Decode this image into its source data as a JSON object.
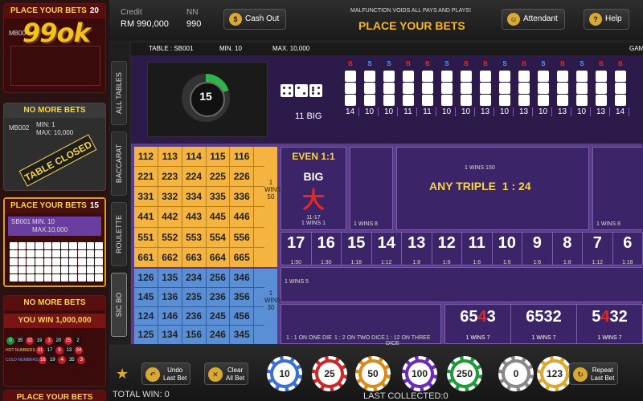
{
  "brand": {
    "logo_text": "99ok"
  },
  "left_panel": {
    "card1": {
      "title": "PLACE YOUR BETS",
      "count": "20",
      "table": "MB00"
    },
    "card2": {
      "title": "NO MORE BETS",
      "table": "MB002",
      "min": "MIN: 1",
      "max": "MAX: 10,000",
      "stamp": "TABLE CLOSED"
    },
    "card3": {
      "title": "PLACE YOUR BETS",
      "count": "15",
      "table": "SB001",
      "min": "MIN. 10",
      "max": "MAX.10,000"
    },
    "card4": {
      "title": "NO MORE BETS",
      "win": "YOU WIN 1,000,000",
      "hot_label": "HOT NUMBERS",
      "cold_label": "COLD NUMBERS",
      "beads1": [
        "0",
        "35",
        "32",
        "19",
        "3",
        "20",
        "25",
        "2"
      ],
      "beads2": [
        "31",
        "17",
        "9",
        "13",
        "34"
      ],
      "beads3": [
        "16",
        "19",
        "4",
        "35",
        "3"
      ]
    },
    "card5": {
      "title": "PLACE YOUR BETS"
    }
  },
  "side_tabs": [
    "ALL TABLES",
    "BACCARAT",
    "ROULETTE",
    "SIC BO"
  ],
  "top_bar": {
    "credit_label": "Credit",
    "credit_value": "RM 990,000",
    "nn_label": "NN",
    "nn_value": "990",
    "cashout": "Cash Out",
    "malfunction": "MALFUNCTION VOIDS ALL PAYS AND PLAYS!",
    "status": "PLACE YOUR BETS",
    "attendant": "Attendant",
    "help": "Help"
  },
  "table_info": {
    "table": "TABLE : SB001",
    "min": "MIN.   10",
    "max": "MAX.  10,000",
    "right": "GAM"
  },
  "timer": {
    "value": "15",
    "progress": 0.2
  },
  "last_result": {
    "label": "11 BIG"
  },
  "history": {
    "bs": [
      "B",
      "S",
      "S",
      "B",
      "B",
      "S",
      "B",
      "B",
      "S",
      "B",
      "S",
      "B",
      "S",
      "B",
      "B"
    ],
    "totals": [
      "14",
      "10",
      "10",
      "11",
      "11",
      "10",
      "10",
      "13",
      "10",
      "13",
      "10",
      "13",
      "10",
      "13",
      "14"
    ]
  },
  "big_area": {
    "even": "EVEN 1:1",
    "big": "BIG",
    "char": "大",
    "range": "11-17",
    "wins": "1 WINS 1"
  },
  "triples": {
    "any": "ANY TRIPLE",
    "odds": "1 : 24",
    "wins150": "1 WINS 150",
    "wins8a": "1 WINS 8",
    "wins8b": "1 WINS 8"
  },
  "grid_triples": [
    [
      "112",
      "113",
      "114",
      "115",
      "116"
    ],
    [
      "221",
      "223",
      "224",
      "225",
      "226"
    ],
    [
      "331",
      "332",
      "334",
      "335",
      "336"
    ],
    [
      "441",
      "442",
      "443",
      "445",
      "446"
    ],
    [
      "551",
      "552",
      "553",
      "554",
      "556"
    ],
    [
      "661",
      "662",
      "663",
      "664",
      "665"
    ]
  ],
  "grid_wins_a": "1 WINS 50",
  "grid_combos": [
    [
      "126",
      "135",
      "234",
      "256",
      "346"
    ],
    [
      "145",
      "136",
      "235",
      "236",
      "356"
    ],
    [
      "124",
      "146",
      "236",
      "245",
      "456"
    ],
    [
      "125",
      "134",
      "156",
      "246",
      "345"
    ]
  ],
  "grid_wins_b": "1 WINS 30",
  "totals": [
    {
      "n": "17",
      "o": "1:50"
    },
    {
      "n": "16",
      "o": "1:30"
    },
    {
      "n": "15",
      "o": "1:18"
    },
    {
      "n": "14",
      "o": "1:12"
    },
    {
      "n": "13",
      "o": "1:8"
    },
    {
      "n": "12",
      "o": "1:6"
    },
    {
      "n": "11",
      "o": "1:6"
    },
    {
      "n": "10",
      "o": "1:6"
    },
    {
      "n": "9",
      "o": "1:6"
    },
    {
      "n": "8",
      "o": "1:8"
    },
    {
      "n": "7",
      "o": "1:12"
    },
    {
      "n": "6",
      "o": "1:18"
    }
  ],
  "combo_wins": "1 WINS 5",
  "singles": {
    "one": "1 : 1 ON ONE DIE",
    "two": "1 : 2 ON TWO DICE",
    "three": "1 : 12 ON THREE DICE"
  },
  "sequences": [
    {
      "d": [
        "6",
        "5",
        "4",
        "3"
      ],
      "red": 2,
      "wins": "1 WINS 7"
    },
    {
      "d": [
        "6",
        "5",
        "3",
        "2"
      ],
      "red": -1,
      "wins": "1 WINS 7"
    },
    {
      "d": [
        "5",
        "4",
        "3",
        "2"
      ],
      "red": 1,
      "wins": "1 WINS 7"
    }
  ],
  "bottom_bar": {
    "undo": "Undo\nLast Bet",
    "clear": "Clear\nAll Bet",
    "repeat": "Repeat\nLast Bet",
    "total_win": "TOTAL WIN: 0",
    "last_collected": "LAST COLLECTED:0",
    "chips": [
      {
        "v": "10",
        "c": "#3b6fd0"
      },
      {
        "v": "25",
        "c": "#c72a2a"
      },
      {
        "v": "50",
        "c": "#d98b1a"
      },
      {
        "v": "100",
        "c": "#6a2bb8"
      },
      {
        "v": "250",
        "c": "#1f9a3a"
      },
      {
        "v": "0",
        "c": "#888888"
      },
      {
        "v": "123",
        "c": "#d9a933"
      }
    ]
  }
}
